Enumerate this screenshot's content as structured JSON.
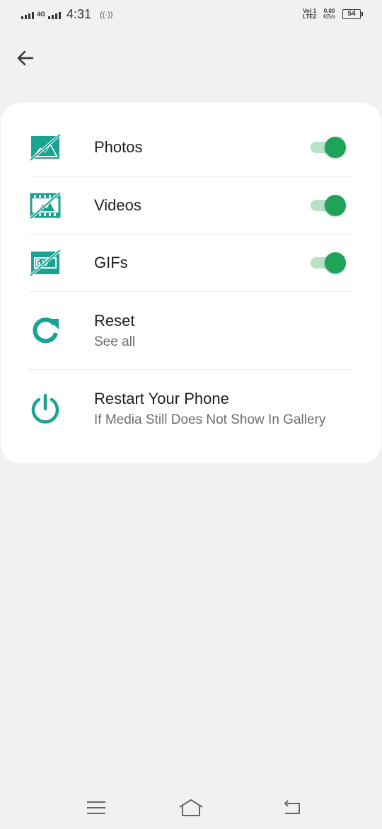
{
  "status_bar": {
    "network": "4G",
    "time": "4:31",
    "volte": "Vo) 1",
    "lte": "LTE2",
    "speed_value": "0.00",
    "speed_unit": "KB/s",
    "battery": "54"
  },
  "settings": {
    "items": [
      {
        "title": "Photos",
        "icon": "photo-off-icon",
        "toggle": true
      },
      {
        "title": "Videos",
        "icon": "video-off-icon",
        "toggle": true
      },
      {
        "title": "GIFs",
        "icon": "gif-off-icon",
        "toggle": true
      },
      {
        "title": "Reset",
        "subtitle": "See all",
        "icon": "refresh-icon"
      },
      {
        "title": "Restart Your Phone",
        "subtitle": "If Media Still Does Not Show In Gallery",
        "icon": "power-icon"
      }
    ]
  },
  "colors": {
    "accent": "#1aa392",
    "toggle_on": "#1fa35b",
    "toggle_track": "#b7e2c8",
    "background": "#f1f1f2"
  }
}
